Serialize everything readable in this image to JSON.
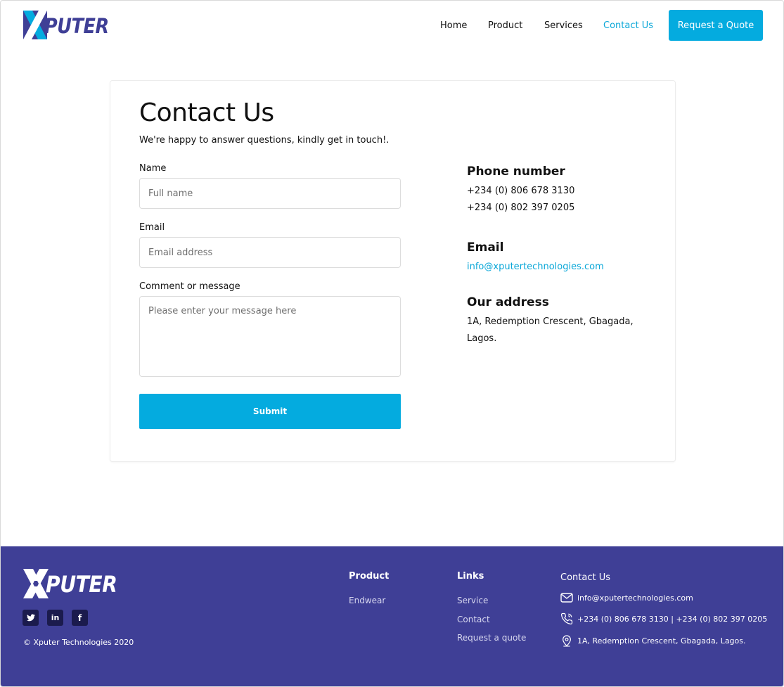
{
  "brand": {
    "name": "PUTER",
    "logo_mark": "X"
  },
  "colors": {
    "accent": "#04abdf",
    "footer_bg": "#3f3f96",
    "link": "#0aa7d8"
  },
  "nav": {
    "items": [
      "Home",
      "Product",
      "Services",
      "Contact Us"
    ],
    "active": "Contact Us",
    "cta": "Request a Quote"
  },
  "contact": {
    "title": "Contact Us",
    "subtitle": "We're happy to answer questions, kindly get in touch!.",
    "form": {
      "name_label": "Name",
      "name_placeholder": "Full name",
      "email_label": "Email",
      "email_placeholder": "Email address",
      "message_label": "Comment or message",
      "message_placeholder": "Please enter your message here",
      "submit": "Submit"
    },
    "info": {
      "phone_heading": "Phone number",
      "phones": [
        "+234 (0) 806 678 3130",
        "+234 (0) 802 397 0205"
      ],
      "email_heading": "Email",
      "email": "info@xputertechnologies.com",
      "address_heading": "Our address",
      "address_lines": [
        "1A, Redemption Crescent, Gbagada,",
        "Lagos."
      ]
    }
  },
  "footer": {
    "social": [
      {
        "icon": "twitter-icon",
        "glyph": "t"
      },
      {
        "icon": "linkedin-icon",
        "glyph": "in"
      },
      {
        "icon": "facebook-icon",
        "glyph": "f"
      }
    ],
    "copyright": "© Xputer Technologies 2020",
    "product": {
      "heading": "Product",
      "links": [
        "Endwear"
      ]
    },
    "links": {
      "heading": "Links",
      "links": [
        "Service",
        "Contact",
        "Request a quote"
      ]
    },
    "contact": {
      "heading": "Contact Us",
      "email": "info@xputertechnologies.com",
      "phone": "+234 (0) 806 678 3130 | +234 (0) 802 397 0205",
      "address": "1A, Redemption Crescent, Gbagada, Lagos."
    }
  }
}
